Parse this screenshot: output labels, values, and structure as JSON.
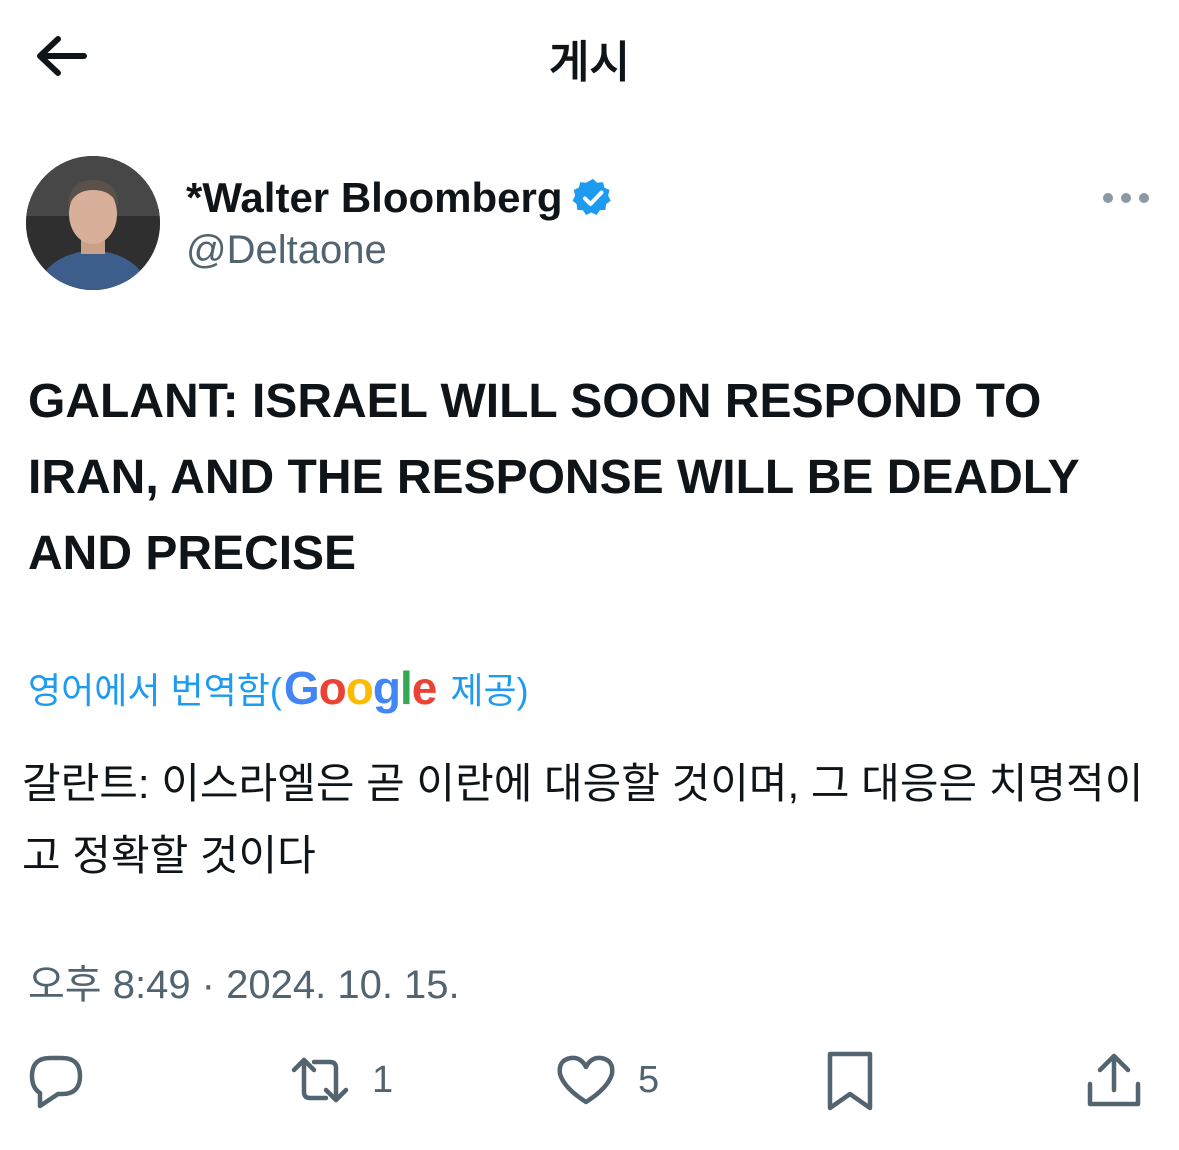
{
  "header": {
    "title": "게시",
    "back_icon": "arrow-left-icon"
  },
  "author": {
    "display_name": "*Walter Bloomberg",
    "handle": "@Deltaone",
    "verified": true,
    "verified_color": "#1d9bf0"
  },
  "tweet": {
    "text": "GALANT: ISRAEL WILL SOON RESPOND TO IRAN, AND THE RESPONSE WILL BE DEADLY AND PRECISE"
  },
  "translation": {
    "label_prefix": "영어에서 번역함(",
    "provider": "Google",
    "label_suffix": "제공)",
    "text": "갈란트: 이스라엘은 곧 이란에 대응할 것이며, 그 대응은 치명적이고 정확할 것이다"
  },
  "timestamp": "오후 8:49 · 2024. 10. 15.",
  "actions": {
    "reply": {
      "icon": "reply-icon",
      "count": ""
    },
    "repost": {
      "icon": "repost-icon",
      "count": "1"
    },
    "like": {
      "icon": "heart-icon",
      "count": "5"
    },
    "bookmark": {
      "icon": "bookmark-icon",
      "count": ""
    },
    "share": {
      "icon": "share-icon",
      "count": ""
    }
  },
  "colors": {
    "accent": "#1d9bf0",
    "secondary_text": "#536471",
    "icon": "#536471"
  }
}
